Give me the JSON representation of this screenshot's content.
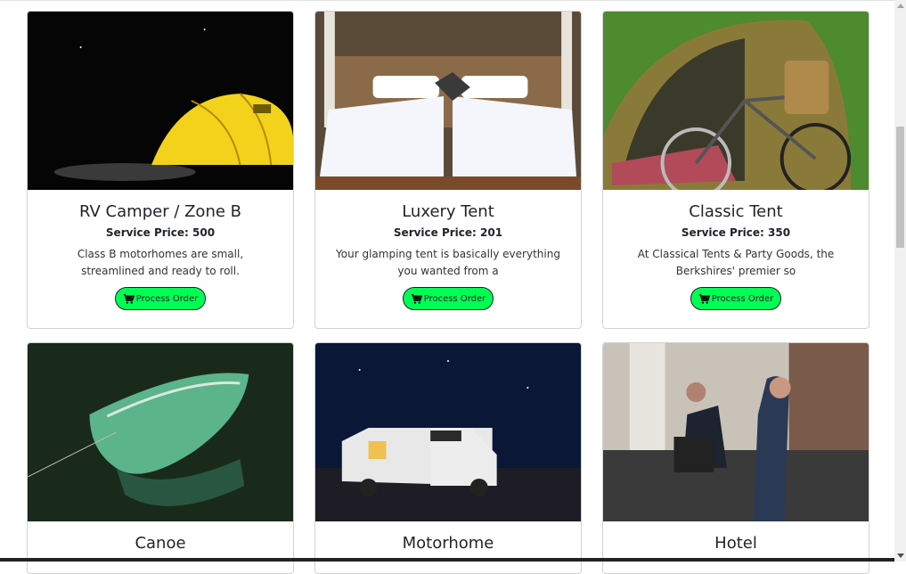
{
  "cards": [
    {
      "title": "RV Camper / Zone B",
      "price": "Service Price: 500",
      "desc": "Class B motorhomes are small, streamlined and ready to roll.",
      "button": "Process Order",
      "image": "yellow-tent-night"
    },
    {
      "title": "Luxery Tent",
      "price": "Service Price: 201",
      "desc": "Your glamping tent is basically everything you wanted from a",
      "button": "Process Order",
      "image": "luxury-beds"
    },
    {
      "title": "Classic Tent",
      "price": "Service Price: 350",
      "desc": "At Classical Tents & Party Goods, the Berkshires' premier so",
      "button": "Process Order",
      "image": "tent-with-bicycle"
    },
    {
      "title": "Canoe",
      "image": "green-canoe"
    },
    {
      "title": "Motorhome",
      "image": "motorhome-night"
    },
    {
      "title": "Hotel",
      "image": "hotel-reception"
    }
  ],
  "colors": {
    "button": "#00ff55",
    "card_border": "#cfd3d7"
  },
  "icons": {
    "cart": "cart-icon"
  }
}
